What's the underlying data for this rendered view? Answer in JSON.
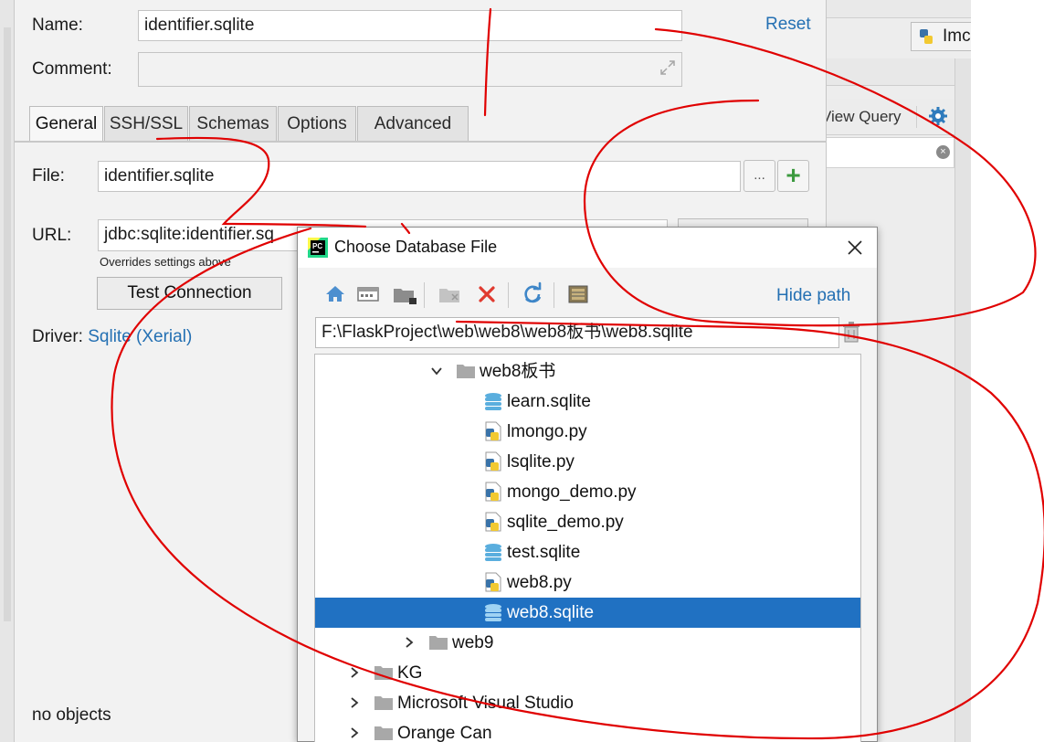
{
  "form": {
    "name_label": "Name:",
    "name_value": "identifier.sqlite",
    "reset_label": "Reset",
    "comment_label": "Comment:",
    "comment_value": "",
    "tabs": [
      "General",
      "SSH/SSL",
      "Schemas",
      "Options",
      "Advanced"
    ],
    "active_tab": "General",
    "file_label": "File:",
    "file_value": "identifier.sqlite",
    "browse_label": "...",
    "add_label": "+",
    "url_label": "URL:",
    "url_value": "jdbc:sqlite:identifier.sq",
    "overrides_note": "Overrides settings above",
    "test_button": "Test Connection",
    "driver_label": "Driver:",
    "driver_value": "Sqlite (Xerial)",
    "status": "no objects"
  },
  "background": {
    "top_button_label": "Imc",
    "view_query_label": "View Query",
    "clear_glyph": "×"
  },
  "dialog": {
    "title": "Choose Database File",
    "hide_path": "Hide path",
    "path_value": "F:\\FlaskProject\\web\\web8\\web8板书\\web8.sqlite",
    "toolbar_icons": [
      "home-icon",
      "desktop-icon",
      "project-folder-icon",
      "new-folder-icon",
      "delete-icon",
      "refresh-icon",
      "show-hidden-icon"
    ],
    "tree": [
      {
        "label": "web8板书",
        "type": "folder",
        "expanded": true
      },
      {
        "label": "learn.sqlite",
        "type": "db"
      },
      {
        "label": "lmongo.py",
        "type": "python"
      },
      {
        "label": "lsqlite.py",
        "type": "python"
      },
      {
        "label": "mongo_demo.py",
        "type": "python"
      },
      {
        "label": "sqlite_demo.py",
        "type": "python"
      },
      {
        "label": "test.sqlite",
        "type": "db"
      },
      {
        "label": "web8.py",
        "type": "python"
      },
      {
        "label": "web8.sqlite",
        "type": "db",
        "selected": true
      },
      {
        "label": "web9",
        "type": "folder",
        "expanded": false
      },
      {
        "label": "KG",
        "type": "folder",
        "expanded": false
      },
      {
        "label": "Microsoft Visual Studio",
        "type": "folder",
        "expanded": false
      },
      {
        "label": "Orange Can",
        "type": "folder",
        "expanded": false
      }
    ]
  },
  "colors": {
    "link": "#2470b3",
    "selection": "#2071c2",
    "annotation": "#e00000"
  }
}
